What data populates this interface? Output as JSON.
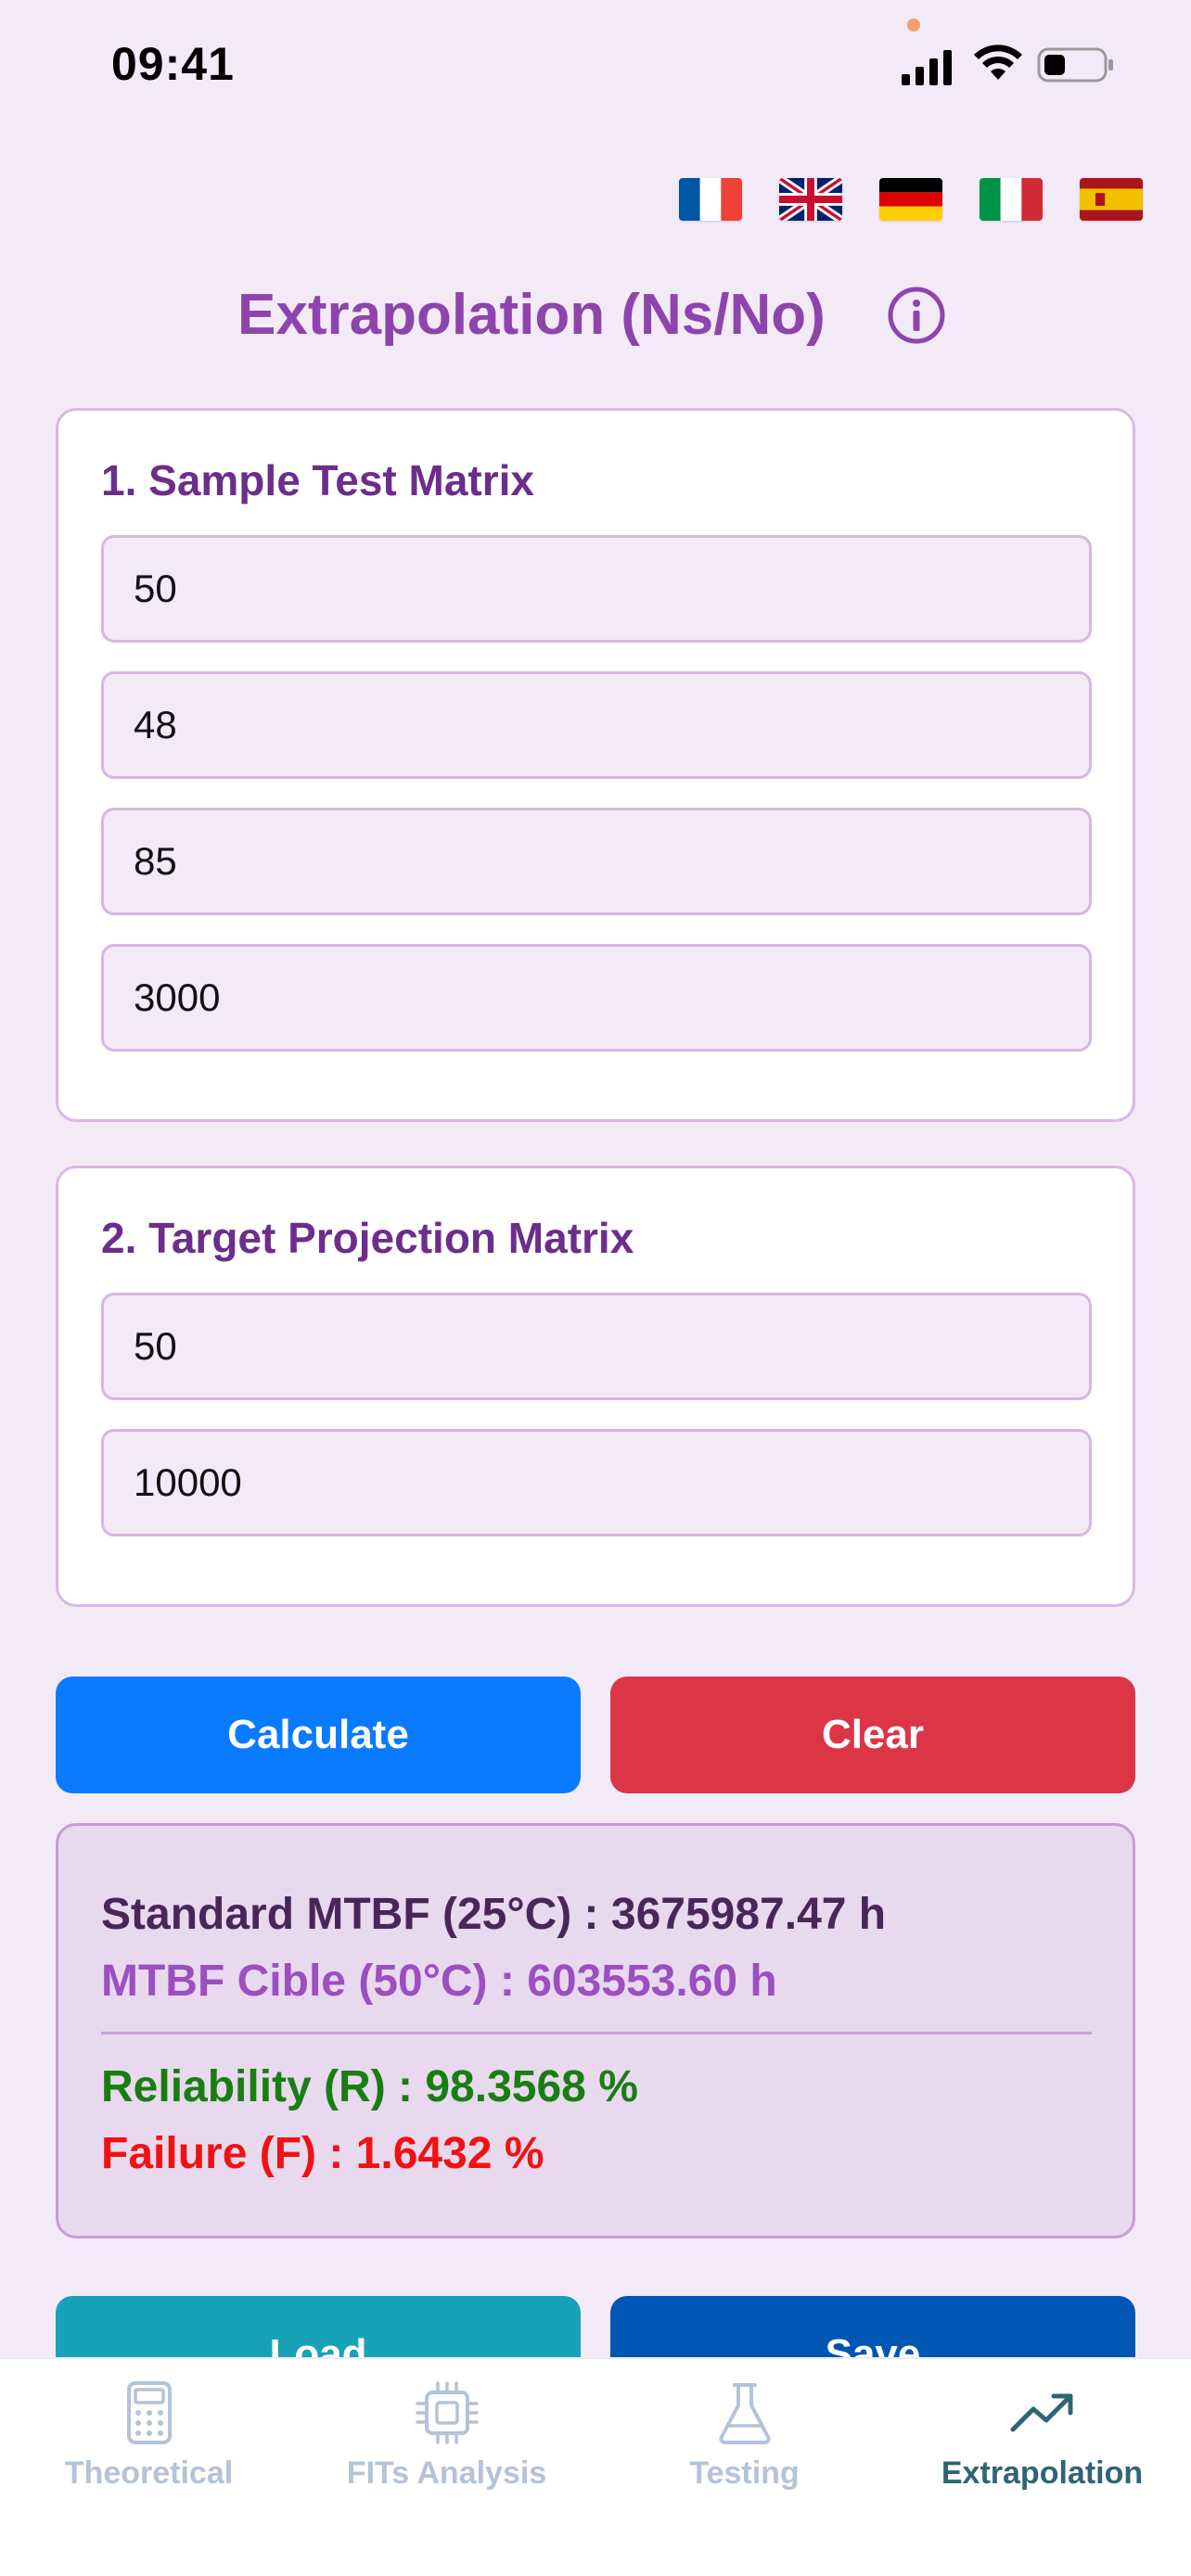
{
  "status_bar": {
    "time": "09:41"
  },
  "languages": [
    {
      "code": "fr",
      "icon": "flag-france"
    },
    {
      "code": "en",
      "icon": "flag-uk"
    },
    {
      "code": "de",
      "icon": "flag-germany"
    },
    {
      "code": "it",
      "icon": "flag-italy"
    },
    {
      "code": "es",
      "icon": "flag-spain"
    }
  ],
  "header": {
    "title": "Extrapolation (Ns/No)",
    "info_icon": "info-icon"
  },
  "sample_matrix": {
    "title": "1. Sample Test Matrix",
    "fields": [
      "50",
      "48",
      "85",
      "3000"
    ]
  },
  "target_matrix": {
    "title": "2. Target Projection Matrix",
    "fields": [
      "50",
      "10000"
    ]
  },
  "actions": {
    "calculate": "Calculate",
    "clear": "Clear",
    "load": "Load",
    "save": "Save"
  },
  "results": {
    "standard_mtbf": "Standard MTBF (25°C) : 3675987.47 h",
    "target_mtbf": "MTBF Cible (50°C) : 603553.60 h",
    "reliability": "Reliability (R) : 98.3568 %",
    "failure": "Failure (F) : 1.6432 %"
  },
  "tabs": [
    {
      "label": "Theoretical",
      "icon": "calculator-icon",
      "active": false
    },
    {
      "label": "FITs Analysis",
      "icon": "chip-icon",
      "active": false
    },
    {
      "label": "Testing",
      "icon": "flask-icon",
      "active": false
    },
    {
      "label": "Extrapolation",
      "icon": "trend-up-icon",
      "active": true
    }
  ],
  "colors": {
    "background": "#f3eaf7",
    "title": "#8e44ad",
    "calculate": "#0a7bff",
    "clear": "#dc3545",
    "load": "#17a2b8",
    "save": "#0056b3",
    "reliability": "#1a7d12",
    "failure": "#f01212",
    "tab_active": "#2f6575",
    "tab_inactive": "#b3c3d8"
  }
}
